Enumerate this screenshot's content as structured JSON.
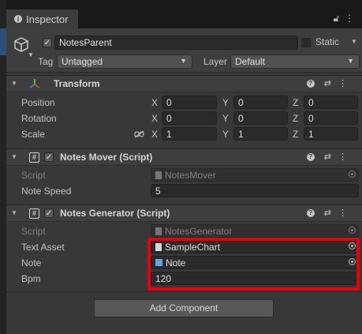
{
  "tab": {
    "title": "Inspector"
  },
  "object": {
    "name": "NotesParent",
    "active": true,
    "static_label": "Static",
    "static": false,
    "tag_label": "Tag",
    "tag_value": "Untagged",
    "layer_label": "Layer",
    "layer_value": "Default"
  },
  "transform": {
    "title": "Transform",
    "rows": [
      {
        "label": "Position",
        "x": "0",
        "y": "0",
        "z": "0"
      },
      {
        "label": "Rotation",
        "x": "0",
        "y": "0",
        "z": "0"
      },
      {
        "label": "Scale",
        "x": "1",
        "y": "1",
        "z": "1"
      }
    ],
    "axes": {
      "x": "X",
      "y": "Y",
      "z": "Z"
    }
  },
  "mover": {
    "title": "Notes Mover (Script)",
    "script_label": "Script",
    "script_value": "NotesMover",
    "speed_label": "Note Speed",
    "speed_value": "5"
  },
  "generator": {
    "title": "Notes Generator (Script)",
    "script_label": "Script",
    "script_value": "NotesGenerator",
    "text_asset_label": "Text Asset",
    "text_asset_value": "SampleChart",
    "note_label": "Note",
    "note_value": "Note",
    "bpm_label": "Bpm",
    "bpm_value": "120"
  },
  "add_component": "Add Component",
  "colors": {
    "highlight": "#e5000e",
    "background": "#383838",
    "prefab": "#5fa6e0"
  }
}
